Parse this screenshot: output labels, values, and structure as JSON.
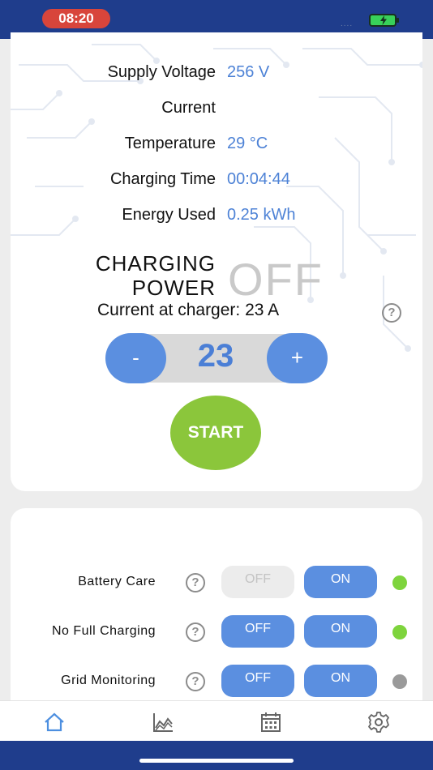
{
  "status_bar": {
    "time": "08:20",
    "signal": "....",
    "colors": {
      "bar": "#1f3d8c",
      "time_pill": "#d8453b",
      "battery": "#38d15a"
    }
  },
  "readings": [
    {
      "label": "Supply Voltage",
      "value": "256 V"
    },
    {
      "label": "Current",
      "value": ""
    },
    {
      "label": "Temperature",
      "value": "29 °C"
    },
    {
      "label": "Charging Time",
      "value": "00:04:44"
    },
    {
      "label": "Energy Used",
      "value": "0.25 kWh"
    }
  ],
  "charging_power": {
    "label_line1": "CHARGING",
    "label_line2": "POWER",
    "value": "OFF"
  },
  "charger_current": {
    "text": "Current at charger: 23 A",
    "help": "?"
  },
  "stepper": {
    "minus": "-",
    "value": "23",
    "plus": "+"
  },
  "start_button": {
    "label": "START",
    "color": "#8bc63b"
  },
  "settings": [
    {
      "label": "Battery Care",
      "help": "?",
      "off": "OFF",
      "on": "ON",
      "off_disabled": true,
      "indicator": "#7ed43d"
    },
    {
      "label": "No Full Charging",
      "help": "?",
      "off": "OFF",
      "on": "ON",
      "off_disabled": false,
      "indicator": "#7ed43d"
    },
    {
      "label": "Grid Monitoring",
      "help": "?",
      "off": "OFF",
      "on": "ON",
      "off_disabled": false,
      "indicator": "#9a9a9a"
    }
  ],
  "tabs": [
    {
      "icon": "home-icon",
      "active": true
    },
    {
      "icon": "chart-icon",
      "active": false
    },
    {
      "icon": "calendar-icon",
      "active": false
    },
    {
      "icon": "gear-icon",
      "active": false
    }
  ],
  "accent": "#4d82d6"
}
